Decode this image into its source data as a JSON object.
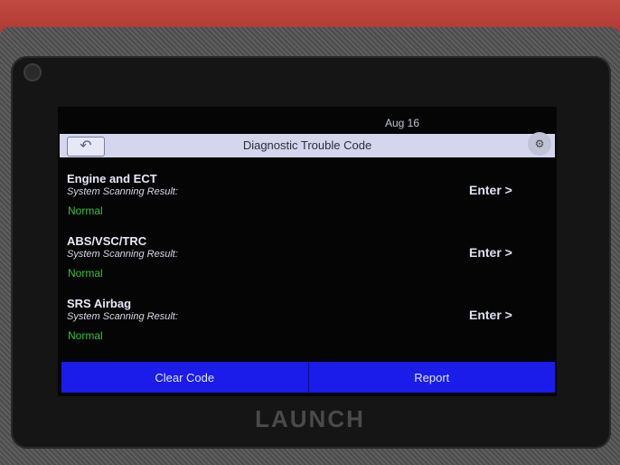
{
  "status_bar": {
    "date": "Aug 16"
  },
  "header": {
    "title": "Diagnostic Trouble Code"
  },
  "systems": [
    {
      "name": "Engine and ECT",
      "scan_label": "System Scanning Result:",
      "result": "Normal",
      "enter_label": "Enter >"
    },
    {
      "name": "ABS/VSC/TRC",
      "scan_label": "System Scanning Result:",
      "result": "Normal",
      "enter_label": "Enter >"
    },
    {
      "name": "SRS Airbag",
      "scan_label": "System Scanning Result:",
      "result": "Normal",
      "enter_label": "Enter >"
    }
  ],
  "actions": {
    "clear_code": "Clear Code",
    "report": "Report"
  },
  "device": {
    "brand": "LAUNCH"
  },
  "colors": {
    "action_bar": "#1b1bea",
    "result_ok": "#35c23b",
    "title_bar": "#d4d6ee",
    "device_accent": "#c24a43"
  },
  "icons": {
    "back": "back-arrow-icon",
    "corner": "settings-icon"
  }
}
